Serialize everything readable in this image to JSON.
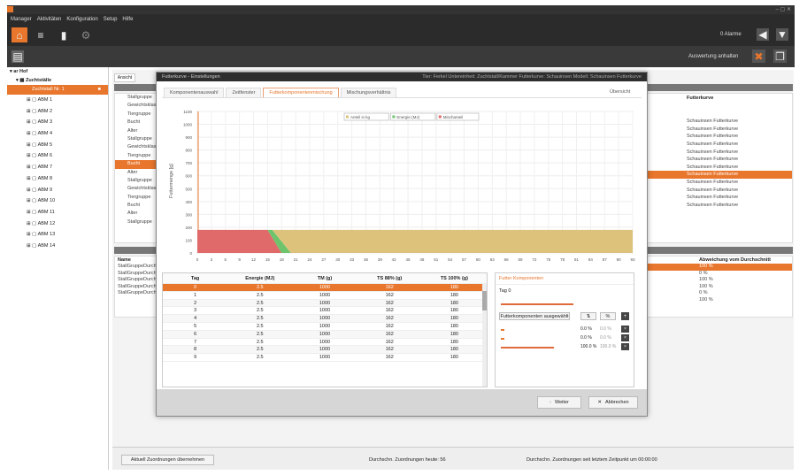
{
  "menu": [
    "Manager",
    "Aktivitäten",
    "Konfiguration",
    "Setup",
    "Hilfe"
  ],
  "top": {
    "alarms": "0 Alarme"
  },
  "sub": {
    "action": "Auswertung anhalten"
  },
  "tree": {
    "root": "ar Hof",
    "group": "Zuchtställe",
    "selected": "Zuchtstall Nr. 1",
    "items": [
      "ABM 1",
      "ABM 2",
      "ABM 3",
      "ABM 4",
      "ABM 5",
      "ABM 6",
      "ABM 7",
      "ABM 8",
      "ABM 9",
      "ABM 10",
      "ABM 11",
      "ABM 12",
      "ABM 13",
      "ABM 14"
    ]
  },
  "bg": {
    "tab_a": "Ansicht",
    "col_feed": "Futterkurve",
    "col_dev": "Abweichung vom Durchschnitt",
    "bottom_left": "Name",
    "rows_bg": [
      "StallGruppeDurchschnitt",
      "StallGruppeDurchschnitt",
      "StallGruppeDurchschnitt",
      "StallGruppeDurchschnitt",
      "StallGruppeDurchschnitt"
    ],
    "left_labels": [
      "Stallgruppe",
      "Gewichtsklasse",
      "Tiergruppe",
      "Bucht",
      "Alter"
    ],
    "right_values": [
      "",
      "",
      "Schauinsen Futterkurve",
      "Schauinsen Futterkurve",
      "Schauinsen Futterkurve",
      "Schauinsen Futterkurve",
      "Schauinsen Futterkurve",
      "Schauinsen Futterkurve",
      "Schauinsen Futterkurve",
      "Schauinsen Futterkurve",
      "Schauinsen Futterkurve",
      "Schauinsen Futterkurve",
      "Schauinsen Futterkurve",
      "Schauinsen Futterkurve"
    ],
    "dev_values": [
      "100 %",
      "0 %",
      "100 %",
      "100 %",
      "0 %",
      "100 %"
    ],
    "status_button": "Aktuell Zuordnungen übernehmen",
    "status1": "Durchschn. Zuordnungen heute: 56",
    "status2": "Durchschn. Zuordnungen seit letztem Zeitpunkt um 00:00:00"
  },
  "dialog": {
    "title": "Futterkurve - Einstellungen",
    "header_info": "Tier: Ferkel  Untereinheit: Zuchtstall/Kammer  Futterkurve: Schauinsen  Modell: Schauinsen Futterkurve",
    "tabs": [
      "Komponentenauswahl",
      "Zeitfenster",
      "Futterkomponentenmischung",
      "Mischungsverhältnis"
    ],
    "overview": "Übersicht",
    "legend": [
      "Anteil in kg",
      "Energie (MJ)",
      "Mischanteil"
    ],
    "table_headers": [
      "Tag",
      "Energie (MJ)",
      "TM (g)",
      "TS 88% (g)",
      "TS 100% (g)"
    ],
    "rows": [
      [
        "0",
        "2.5",
        "1000",
        "162",
        "180"
      ],
      [
        "1",
        "2.5",
        "1000",
        "162",
        "180"
      ],
      [
        "2",
        "2.5",
        "1000",
        "162",
        "180"
      ],
      [
        "3",
        "2.5",
        "1000",
        "162",
        "180"
      ],
      [
        "4",
        "2.5",
        "1000",
        "162",
        "180"
      ],
      [
        "5",
        "2.5",
        "1000",
        "162",
        "180"
      ],
      [
        "6",
        "2.5",
        "1000",
        "162",
        "180"
      ],
      [
        "7",
        "2.5",
        "1000",
        "162",
        "180"
      ],
      [
        "8",
        "2.5",
        "1000",
        "162",
        "180"
      ],
      [
        "9",
        "2.5",
        "1000",
        "162",
        "180"
      ]
    ],
    "panel_title": "Futter Komponenten",
    "panel_day": "Tag 0",
    "panel_btn": "Futterkomponenten ausgewählt",
    "panel_pct": [
      "0.0 %",
      "0.0 %",
      "100.0 %"
    ],
    "panel_pct2": [
      "0.0 %",
      "0.0 %",
      "100.0 %"
    ],
    "btn_next": "Weiter",
    "btn_cancel": "Abbrechen"
  },
  "chart_data": {
    "type": "area",
    "ylabel": "Futtermenge [g]",
    "y_ticks": [
      0,
      100,
      200,
      300,
      400,
      500,
      600,
      700,
      800,
      900,
      1000,
      1100
    ],
    "ylim": [
      0,
      1100
    ],
    "x_ticks": [
      0,
      3,
      6,
      9,
      12,
      15,
      18,
      21,
      24,
      27,
      30,
      33,
      36,
      39,
      42,
      45,
      48,
      51,
      54,
      57,
      60,
      63,
      66,
      69,
      72,
      75,
      78,
      81,
      84,
      87,
      90,
      93
    ],
    "xlim": [
      0,
      93
    ],
    "series": [
      {
        "name": "Mischanteil",
        "color": "#e06a6a",
        "x": [
          0,
          15,
          18
        ],
        "y": [
          180,
          180,
          0
        ]
      },
      {
        "name": "Energie (MJ)",
        "color": "#6dc46d",
        "x": [
          15,
          16,
          20,
          18
        ],
        "y": [
          180,
          180,
          0,
          0
        ]
      },
      {
        "name": "Anteil in kg",
        "color": "#dcc27a",
        "x": [
          16,
          93
        ],
        "y": [
          180,
          180
        ]
      }
    ]
  }
}
